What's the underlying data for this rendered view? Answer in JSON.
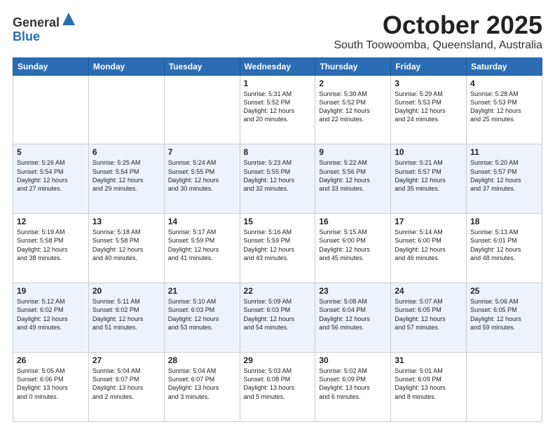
{
  "header": {
    "logo_general": "General",
    "logo_blue": "Blue",
    "month": "October 2025",
    "location": "South Toowoomba, Queensland, Australia"
  },
  "weekdays": [
    "Sunday",
    "Monday",
    "Tuesday",
    "Wednesday",
    "Thursday",
    "Friday",
    "Saturday"
  ],
  "weeks": [
    [
      {
        "day": "",
        "info": ""
      },
      {
        "day": "",
        "info": ""
      },
      {
        "day": "",
        "info": ""
      },
      {
        "day": "1",
        "info": "Sunrise: 5:31 AM\nSunset: 5:52 PM\nDaylight: 12 hours\nand 20 minutes."
      },
      {
        "day": "2",
        "info": "Sunrise: 5:30 AM\nSunset: 5:52 PM\nDaylight: 12 hours\nand 22 minutes."
      },
      {
        "day": "3",
        "info": "Sunrise: 5:29 AM\nSunset: 5:53 PM\nDaylight: 12 hours\nand 24 minutes."
      },
      {
        "day": "4",
        "info": "Sunrise: 5:28 AM\nSunset: 5:53 PM\nDaylight: 12 hours\nand 25 minutes."
      }
    ],
    [
      {
        "day": "5",
        "info": "Sunrise: 5:26 AM\nSunset: 5:54 PM\nDaylight: 12 hours\nand 27 minutes."
      },
      {
        "day": "6",
        "info": "Sunrise: 5:25 AM\nSunset: 5:54 PM\nDaylight: 12 hours\nand 29 minutes."
      },
      {
        "day": "7",
        "info": "Sunrise: 5:24 AM\nSunset: 5:55 PM\nDaylight: 12 hours\nand 30 minutes."
      },
      {
        "day": "8",
        "info": "Sunrise: 5:23 AM\nSunset: 5:55 PM\nDaylight: 12 hours\nand 32 minutes."
      },
      {
        "day": "9",
        "info": "Sunrise: 5:22 AM\nSunset: 5:56 PM\nDaylight: 12 hours\nand 33 minutes."
      },
      {
        "day": "10",
        "info": "Sunrise: 5:21 AM\nSunset: 5:57 PM\nDaylight: 12 hours\nand 35 minutes."
      },
      {
        "day": "11",
        "info": "Sunrise: 5:20 AM\nSunset: 5:57 PM\nDaylight: 12 hours\nand 37 minutes."
      }
    ],
    [
      {
        "day": "12",
        "info": "Sunrise: 5:19 AM\nSunset: 5:58 PM\nDaylight: 12 hours\nand 38 minutes."
      },
      {
        "day": "13",
        "info": "Sunrise: 5:18 AM\nSunset: 5:58 PM\nDaylight: 12 hours\nand 40 minutes."
      },
      {
        "day": "14",
        "info": "Sunrise: 5:17 AM\nSunset: 5:59 PM\nDaylight: 12 hours\nand 41 minutes."
      },
      {
        "day": "15",
        "info": "Sunrise: 5:16 AM\nSunset: 5:59 PM\nDaylight: 12 hours\nand 43 minutes."
      },
      {
        "day": "16",
        "info": "Sunrise: 5:15 AM\nSunset: 6:00 PM\nDaylight: 12 hours\nand 45 minutes."
      },
      {
        "day": "17",
        "info": "Sunrise: 5:14 AM\nSunset: 6:00 PM\nDaylight: 12 hours\nand 46 minutes."
      },
      {
        "day": "18",
        "info": "Sunrise: 5:13 AM\nSunset: 6:01 PM\nDaylight: 12 hours\nand 48 minutes."
      }
    ],
    [
      {
        "day": "19",
        "info": "Sunrise: 5:12 AM\nSunset: 6:02 PM\nDaylight: 12 hours\nand 49 minutes."
      },
      {
        "day": "20",
        "info": "Sunrise: 5:11 AM\nSunset: 6:02 PM\nDaylight: 12 hours\nand 51 minutes."
      },
      {
        "day": "21",
        "info": "Sunrise: 5:10 AM\nSunset: 6:03 PM\nDaylight: 12 hours\nand 53 minutes."
      },
      {
        "day": "22",
        "info": "Sunrise: 5:09 AM\nSunset: 6:03 PM\nDaylight: 12 hours\nand 54 minutes."
      },
      {
        "day": "23",
        "info": "Sunrise: 5:08 AM\nSunset: 6:04 PM\nDaylight: 12 hours\nand 56 minutes."
      },
      {
        "day": "24",
        "info": "Sunrise: 5:07 AM\nSunset: 6:05 PM\nDaylight: 12 hours\nand 57 minutes."
      },
      {
        "day": "25",
        "info": "Sunrise: 5:06 AM\nSunset: 6:05 PM\nDaylight: 12 hours\nand 59 minutes."
      }
    ],
    [
      {
        "day": "26",
        "info": "Sunrise: 5:05 AM\nSunset: 6:06 PM\nDaylight: 13 hours\nand 0 minutes."
      },
      {
        "day": "27",
        "info": "Sunrise: 5:04 AM\nSunset: 6:07 PM\nDaylight: 13 hours\nand 2 minutes."
      },
      {
        "day": "28",
        "info": "Sunrise: 5:04 AM\nSunset: 6:07 PM\nDaylight: 13 hours\nand 3 minutes."
      },
      {
        "day": "29",
        "info": "Sunrise: 5:03 AM\nSunset: 6:08 PM\nDaylight: 13 hours\nand 5 minutes."
      },
      {
        "day": "30",
        "info": "Sunrise: 5:02 AM\nSunset: 6:09 PM\nDaylight: 13 hours\nand 6 minutes."
      },
      {
        "day": "31",
        "info": "Sunrise: 5:01 AM\nSunset: 6:09 PM\nDaylight: 13 hours\nand 8 minutes."
      },
      {
        "day": "",
        "info": ""
      }
    ]
  ]
}
